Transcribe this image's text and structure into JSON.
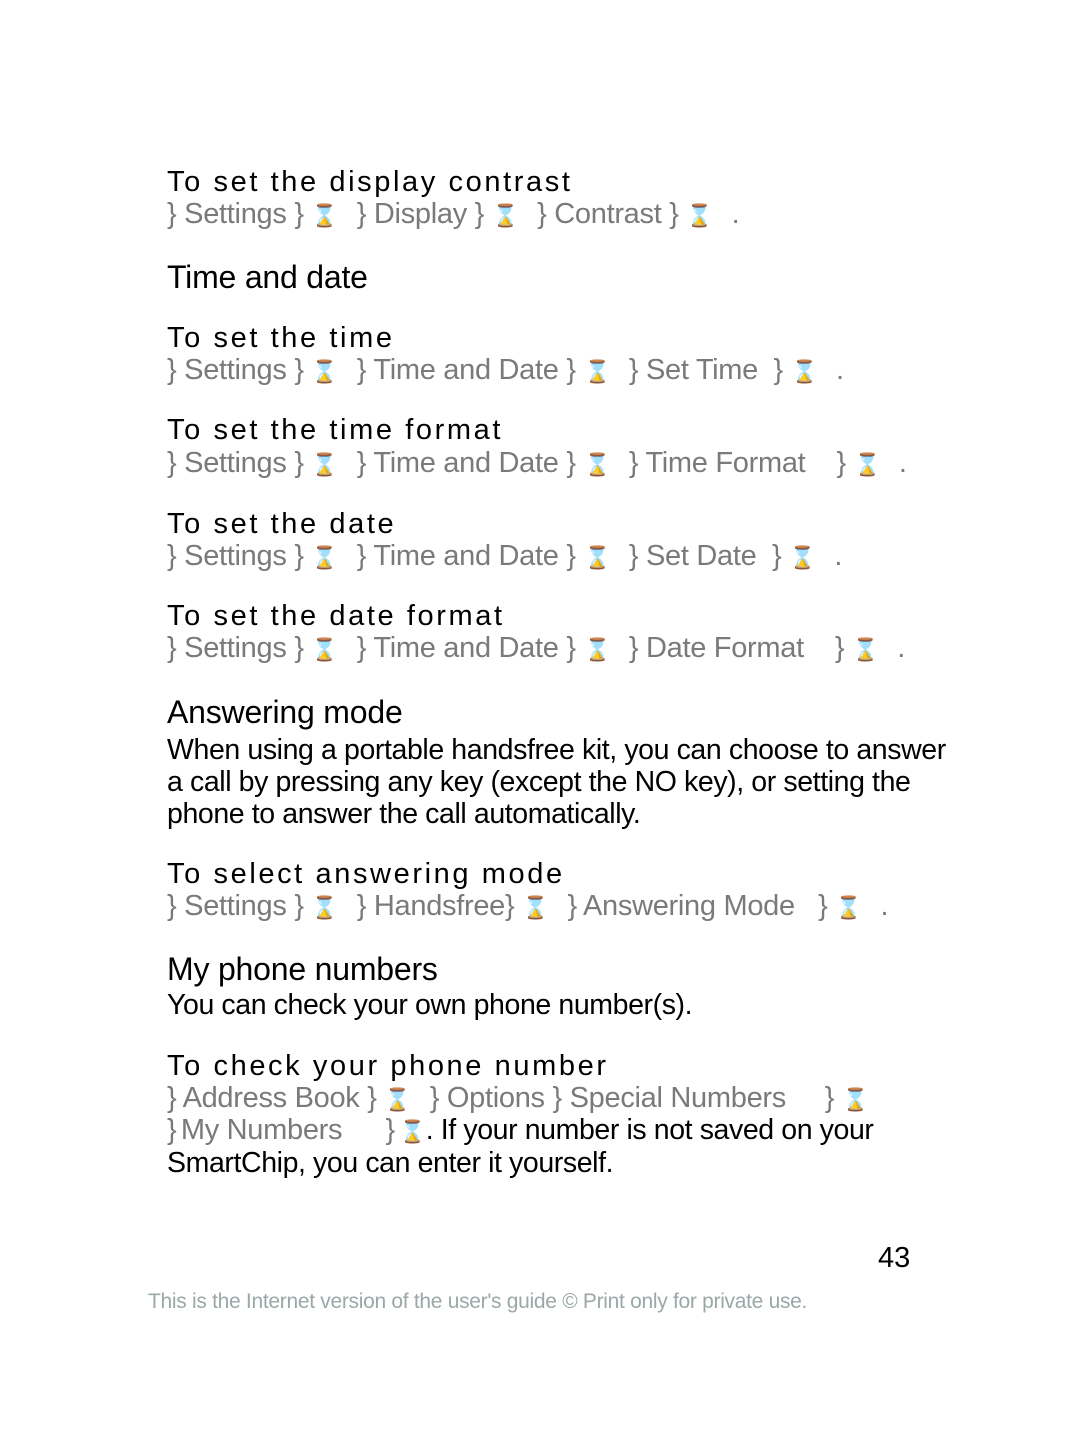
{
  "sections": [
    {
      "type": "subheading",
      "id": "display-contrast",
      "title": "To set the display contrast",
      "path": [
        "Settings",
        "YES",
        "Display",
        "YES",
        "Contrast",
        "YES"
      ],
      "path_rendered": "} Settings } YES } Display } YES } Contrast } YES ."
    },
    {
      "type": "heading",
      "id": "time-and-date",
      "title": "Time and date"
    },
    {
      "type": "subheading",
      "id": "set-time",
      "title": "To set the time",
      "path": [
        "Settings",
        "YES",
        "Time and Date",
        "YES",
        "Set Time",
        "YES"
      ],
      "path_rendered": "} Settings } YES } Time and Date } YES } Set Time } YES ."
    },
    {
      "type": "subheading",
      "id": "set-time-format",
      "title": "To set the time format",
      "path": [
        "Settings",
        "YES",
        "Time and Date",
        "YES",
        "Time Format",
        "YES"
      ],
      "path_rendered": "} Settings } YES } Time and Date } YES } Time Format } YES ."
    },
    {
      "type": "subheading",
      "id": "set-date",
      "title": "To set the date",
      "path": [
        "Settings",
        "YES",
        "Time and Date",
        "YES",
        "Set Date",
        "YES"
      ],
      "path_rendered": "} Settings } YES } Time and Date } YES } Set Date } YES ."
    },
    {
      "type": "subheading",
      "id": "set-date-format",
      "title": "To set the date format",
      "path": [
        "Settings",
        "YES",
        "Time and Date",
        "YES",
        "Date Format",
        "YES"
      ],
      "path_rendered": "} Settings } YES } Time and Date } YES } Date Format } YES ."
    },
    {
      "type": "heading",
      "id": "answering-mode",
      "title": "Answering mode",
      "body_lines": [
        "When using a portable handsfree kit, you can choose to answer",
        "a call by pressing any key (except the NO key), or setting the",
        "phone to answer the call automatically."
      ]
    },
    {
      "type": "subheading",
      "id": "select-answering-mode",
      "title": "To select answering mode",
      "path": [
        "Settings",
        "YES",
        "Handsfree",
        "YES",
        "Answering Mode",
        "YES"
      ],
      "path_rendered": "} Settings } YES } Handsfree } YES } Answering Mode } YES ."
    },
    {
      "type": "heading",
      "id": "my-phone-numbers",
      "title": "My phone numbers",
      "body_lines": [
        "You can check your own phone number(s)."
      ]
    },
    {
      "type": "subheading",
      "id": "check-phone-number",
      "title": "To check your phone number",
      "path": [
        "Address Book",
        "YES",
        "Options",
        "Special Numbers",
        "YES",
        "My Numbers",
        "YES"
      ],
      "path_rendered_line1": "} Address Book } YES } Options } Special Numbers } YES",
      "path_rendered_line2": "} My Numbers } YES",
      "trailing_text": ". If your number is not saved on your",
      "body_lines": [
        "SmartChip, you can enter it yourself."
      ]
    }
  ],
  "page_number": "43",
  "footer": "This is the Internet version of the user's guide © Print only for private use."
}
